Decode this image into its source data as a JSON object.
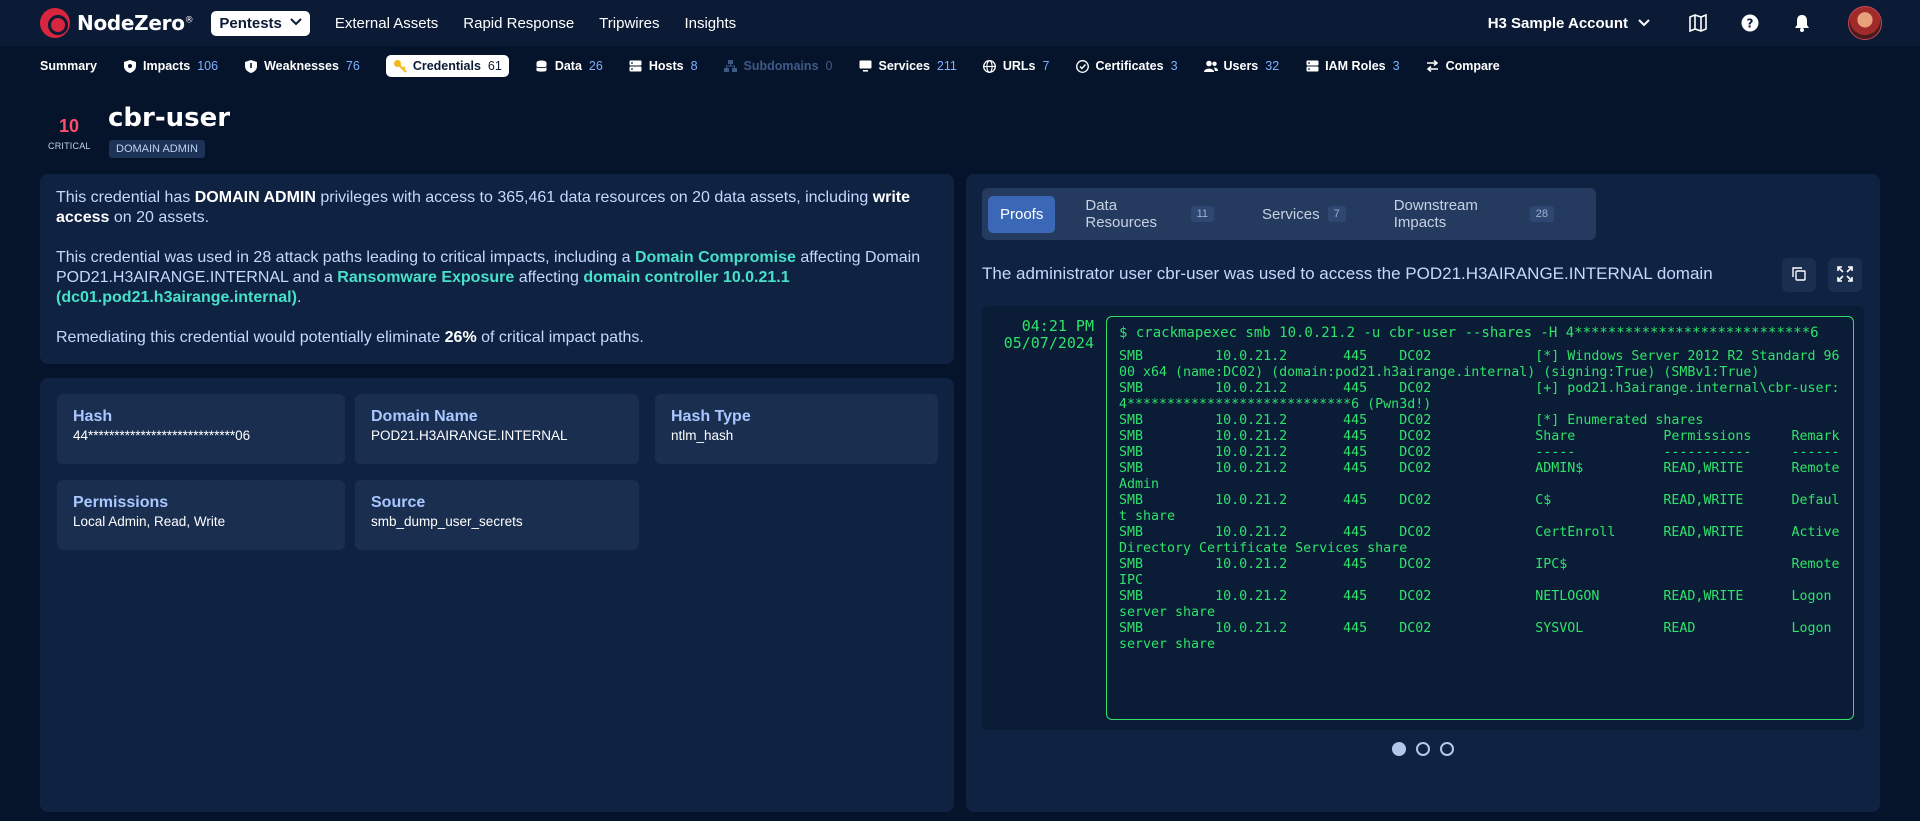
{
  "brand": {
    "name": "NodeZero",
    "mark": "®"
  },
  "nav": {
    "items": [
      {
        "label": "Pentests",
        "active": true
      },
      {
        "label": "External Assets"
      },
      {
        "label": "Rapid Response"
      },
      {
        "label": "Tripwires"
      },
      {
        "label": "Insights"
      }
    ],
    "account": "H3 Sample Account"
  },
  "subnav": [
    {
      "label": "Summary",
      "count": "",
      "icon": "none"
    },
    {
      "label": "Impacts",
      "count": "106",
      "icon": "shield-icon"
    },
    {
      "label": "Weaknesses",
      "count": "76",
      "icon": "shield-icon"
    },
    {
      "label": "Credentials",
      "count": "61",
      "icon": "key-icon",
      "active": true
    },
    {
      "label": "Data",
      "count": "26",
      "icon": "database-icon"
    },
    {
      "label": "Hosts",
      "count": "8",
      "icon": "server-icon"
    },
    {
      "label": "Subdomains",
      "count": "0",
      "icon": "network-icon",
      "disabled": true
    },
    {
      "label": "Services",
      "count": "211",
      "icon": "monitor-icon"
    },
    {
      "label": "URLs",
      "count": "7",
      "icon": "globe-icon"
    },
    {
      "label": "Certificates",
      "count": "3",
      "icon": "certificate-icon"
    },
    {
      "label": "Users",
      "count": "32",
      "icon": "users-icon"
    },
    {
      "label": "IAM Roles",
      "count": "3",
      "icon": "server-icon"
    },
    {
      "label": "Compare",
      "count": "",
      "icon": "compare-icon"
    }
  ],
  "header": {
    "severity_score": "10",
    "severity_label": "CRITICAL",
    "title": "cbr-user",
    "badge": "DOMAIN ADMIN"
  },
  "summary": {
    "p1": [
      {
        "t": "This credential has "
      },
      {
        "t": "DOMAIN ADMIN",
        "b": true
      },
      {
        "t": " privileges with access to 365,461 data resources on 20 data assets, including "
      },
      {
        "t": "write access",
        "b": true
      },
      {
        "t": " on 20 assets."
      }
    ],
    "p2": [
      {
        "t": "This credential was used in 28 attack paths leading to critical impacts, including a "
      },
      {
        "t": "Domain Compromise",
        "hl": true
      },
      {
        "t": " affecting Domain POD21.H3AIRANGE.INTERNAL and a "
      },
      {
        "t": "Ransomware Exposure",
        "hl": true
      },
      {
        "t": " affecting "
      },
      {
        "t": "domain controller 10.0.21.1 (dc01.pod21.h3airange.internal)",
        "hl": true
      },
      {
        "t": "."
      }
    ],
    "p3": [
      {
        "t": "Remediating this credential would potentially eliminate "
      },
      {
        "t": "26%",
        "b": true
      },
      {
        "t": " of critical impact paths."
      }
    ]
  },
  "fields": {
    "hash": {
      "label": "Hash",
      "value": "44****************************06"
    },
    "domain": {
      "label": "Domain Name",
      "value": "POD21.H3AIRANGE.INTERNAL"
    },
    "hash_type": {
      "label": "Hash Type",
      "value": "ntlm_hash"
    },
    "permissions": {
      "label": "Permissions",
      "value": "Local Admin, Read, Write"
    },
    "source": {
      "label": "Source",
      "value": "smb_dump_user_secrets"
    }
  },
  "tabs": [
    {
      "label": "Proofs",
      "count": "",
      "active": true
    },
    {
      "label": "Data Resources",
      "count": "11"
    },
    {
      "label": "Services",
      "count": "7"
    },
    {
      "label": "Downstream Impacts",
      "count": "28"
    }
  ],
  "proof": {
    "title": "The administrator user cbr-user was used to access the POD21.H3AIRANGE.INTERNAL domain",
    "time": "04:21 PM",
    "date": "05/07/2024",
    "command": "$ crackmapexec smb 10.0.21.2 -u cbr-user --shares -H 4****************************6",
    "lines": [
      "SMB         10.0.21.2       445    DC02             [*] Windows Server 2012 R2 Standard 9600 x64 (name:DC02) (domain:pod21.h3airange.internal) (signing:True) (SMBv1:True)",
      "SMB         10.0.21.2       445    DC02             [+] pod21.h3airange.internal\\cbr-user:4****************************6 (Pwn3d!)",
      "SMB         10.0.21.2       445    DC02             [*] Enumerated shares",
      "SMB         10.0.21.2       445    DC02             Share           Permissions     Remark",
      "SMB         10.0.21.2       445    DC02             -----           -----------     ------",
      "SMB         10.0.21.2       445    DC02             ADMIN$          READ,WRITE      Remote Admin",
      "SMB         10.0.21.2       445    DC02             C$              READ,WRITE      Default share",
      "SMB         10.0.21.2       445    DC02             CertEnroll      READ,WRITE      Active Directory Certificate Services share",
      "SMB         10.0.21.2       445    DC02             IPC$                            Remote IPC",
      "SMB         10.0.21.2       445    DC02             NETLOGON        READ,WRITE      Logon server share",
      "SMB         10.0.21.2       445    DC02             SYSVOL          READ            Logon server share"
    ],
    "pages": 3,
    "current_page": 1
  },
  "colors": {
    "accent": "#3a68b7",
    "highlight": "#47e1c9",
    "critical": "#ff4d6d",
    "terminal_green": "#2fe36a"
  }
}
